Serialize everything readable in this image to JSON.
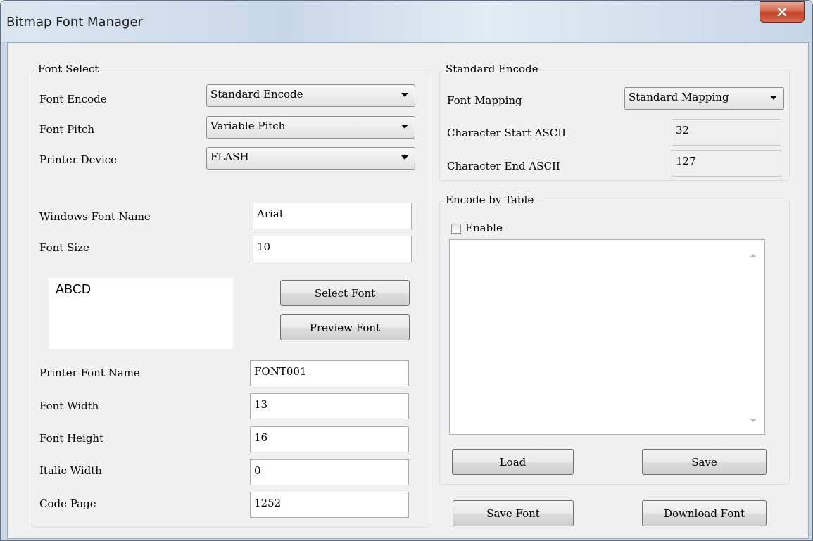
{
  "window": {
    "title": "Bitmap Font Manager"
  },
  "font_select": {
    "legend": "Font Select",
    "font_encode_label": "Font Encode",
    "font_encode_value": "Standard Encode",
    "font_pitch_label": "Font Pitch",
    "font_pitch_value": "Variable Pitch",
    "printer_device_label": "Printer Device",
    "printer_device_value": "FLASH",
    "windows_font_name_label": "Windows Font Name",
    "windows_font_name_value": "Arial",
    "font_size_label": "Font Size",
    "font_size_value": "10",
    "preview_text": "ABCD",
    "select_font_label": "Select Font",
    "preview_font_label": "Preview Font",
    "printer_font_name_label": "Printer Font Name",
    "printer_font_name_value": "FONT001",
    "font_width_label": "Font Width",
    "font_width_value": "13",
    "font_height_label": "Font Height",
    "font_height_value": "16",
    "italic_width_label": "Italic Width",
    "italic_width_value": "0",
    "code_page_label": "Code Page",
    "code_page_value": "1252"
  },
  "standard_encode": {
    "legend": "Standard Encode",
    "font_mapping_label": "Font Mapping",
    "font_mapping_value": "Standard Mapping",
    "char_start_label": "Character Start ASCII",
    "char_start_value": "32",
    "char_end_label": "Character End ASCII",
    "char_end_value": "127"
  },
  "encode_by_table": {
    "legend": "Encode by Table",
    "enable_label": "Enable",
    "enable_checked": false,
    "load_label": "Load",
    "save_label": "Save"
  },
  "footer": {
    "save_font_label": "Save Font",
    "download_font_label": "Download Font"
  },
  "icons": {
    "close": "close-icon"
  }
}
